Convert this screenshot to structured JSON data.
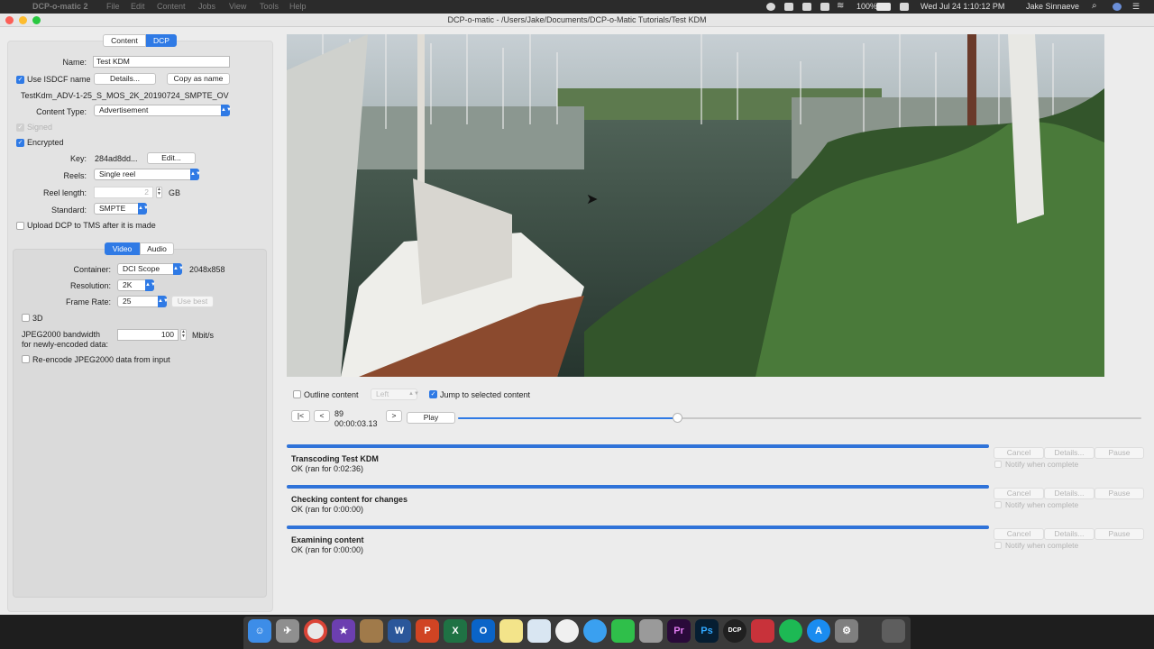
{
  "menubar": {
    "app_name": "DCP-o-matic 2",
    "items": [
      "File",
      "Edit",
      "Content",
      "Jobs",
      "View",
      "Tools",
      "Help"
    ],
    "battery": "100%",
    "datetime": "Wed Jul 24  1:10:12 PM",
    "user": "Jake Sinnaeve"
  },
  "window": {
    "title": "DCP-o-matic - /Users/Jake/Documents/DCP-o-Matic Tutorials/Test KDM"
  },
  "tabs": {
    "content": "Content",
    "dcp": "DCP"
  },
  "dcp": {
    "name_label": "Name:",
    "name_value": "Test KDM",
    "use_isdcf_label": "Use ISDCF name",
    "details_button": "Details...",
    "copy_as_name_button": "Copy as name",
    "isdcf_name": "TestKdm_ADV-1-25_S_MOS_2K_20190724_SMPTE_OV",
    "content_type_label": "Content Type:",
    "content_type_value": "Advertisement",
    "signed_label": "Signed",
    "encrypted_label": "Encrypted",
    "key_label": "Key:",
    "key_value": "284ad8dd...",
    "key_edit_button": "Edit...",
    "reels_label": "Reels:",
    "reels_value": "Single reel",
    "reel_length_label": "Reel length:",
    "reel_length_value": "2",
    "reel_length_unit": "GB",
    "standard_label": "Standard:",
    "standard_value": "SMPTE",
    "upload_label": "Upload DCP to TMS after it is made"
  },
  "subtabs": {
    "video": "Video",
    "audio": "Audio"
  },
  "video": {
    "container_label": "Container:",
    "container_value": "DCI Scope",
    "container_size": "2048x858",
    "resolution_label": "Resolution:",
    "resolution_value": "2K",
    "frame_rate_label": "Frame Rate:",
    "frame_rate_value": "25",
    "use_best_button": "Use best",
    "three_d_label": "3D",
    "bandwidth_label_1": "JPEG2000 bandwidth",
    "bandwidth_label_2": "for newly-encoded data:",
    "bandwidth_value": "100",
    "bandwidth_unit": "Mbit/s",
    "reencode_label": "Re-encode JPEG2000 data from input"
  },
  "viewer": {
    "outline_label": "Outline content",
    "eye_value": "Left",
    "jump_label": "Jump to selected content",
    "start_button": "|<",
    "back_button": "<",
    "frame": "89",
    "timecode": "00:00:03.13",
    "forward_button": ">",
    "play_button": "Play",
    "position_fraction": 0.32
  },
  "jobs": [
    {
      "title": "Transcoding Test KDM",
      "status": "OK (ran for 0:02:36)",
      "progress": 1.0
    },
    {
      "title": "Checking content for changes",
      "status": "OK (ran for 0:00:00)",
      "progress": 1.0
    },
    {
      "title": "Examining content",
      "status": "OK (ran for 0:00:00)",
      "progress": 1.0
    }
  ],
  "job_controls": {
    "cancel": "Cancel",
    "details": "Details...",
    "pause": "Pause",
    "notify": "Notify when complete"
  },
  "dock": [
    "finder-icon",
    "launchpad-icon",
    "chrome-icon",
    "imovie-icon",
    "notes-app-icon",
    "word-icon",
    "powerpoint-icon",
    "excel-icon",
    "outlook-icon",
    "stickies-icon",
    "preview-icon",
    "photos-icon",
    "messages-icon",
    "facetime-icon",
    "filemerge-icon",
    "premiere-icon",
    "photoshop-icon",
    "dcp-o-matic-icon",
    "popcorn-icon",
    "spotify-icon",
    "app-store-icon",
    "system-preferences-icon",
    "trash-icon"
  ],
  "colors": {
    "accent": "#2f7ae5",
    "job_bar": "#2f73d9"
  }
}
